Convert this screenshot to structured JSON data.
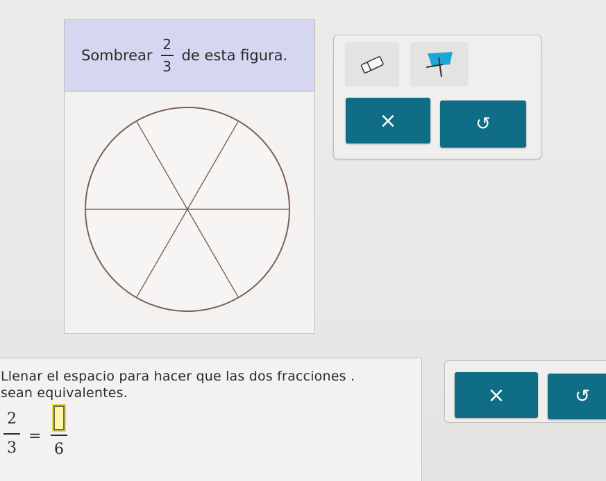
{
  "shade_question": {
    "prefix": "Sombrear",
    "fraction": {
      "numerator": "2",
      "denominator": "3"
    },
    "suffix": "de esta figura."
  },
  "figure": {
    "shape": "circle",
    "sections": 6,
    "shaded_sections": 0
  },
  "tools": {
    "eraser_icon": "eraser-icon",
    "fill_icon": "paint-fill-icon",
    "clear_label": "×",
    "undo_label": "↺"
  },
  "fill_question": {
    "instruction_line1": "Llenar el espacio para hacer que las dos fracciones .",
    "instruction_line2": "sean equivalentes.",
    "left_numerator": "2",
    "left_denominator": "3",
    "equals": "=",
    "right_numerator_value": "",
    "right_denominator": "6",
    "clear_label": "×",
    "undo_label": "↺"
  },
  "colors": {
    "header_bg": "#d5d6ef",
    "action_button": "#0f6e86",
    "input_highlight": "#fff7a8",
    "fill_tool": "#1aa6d6"
  }
}
